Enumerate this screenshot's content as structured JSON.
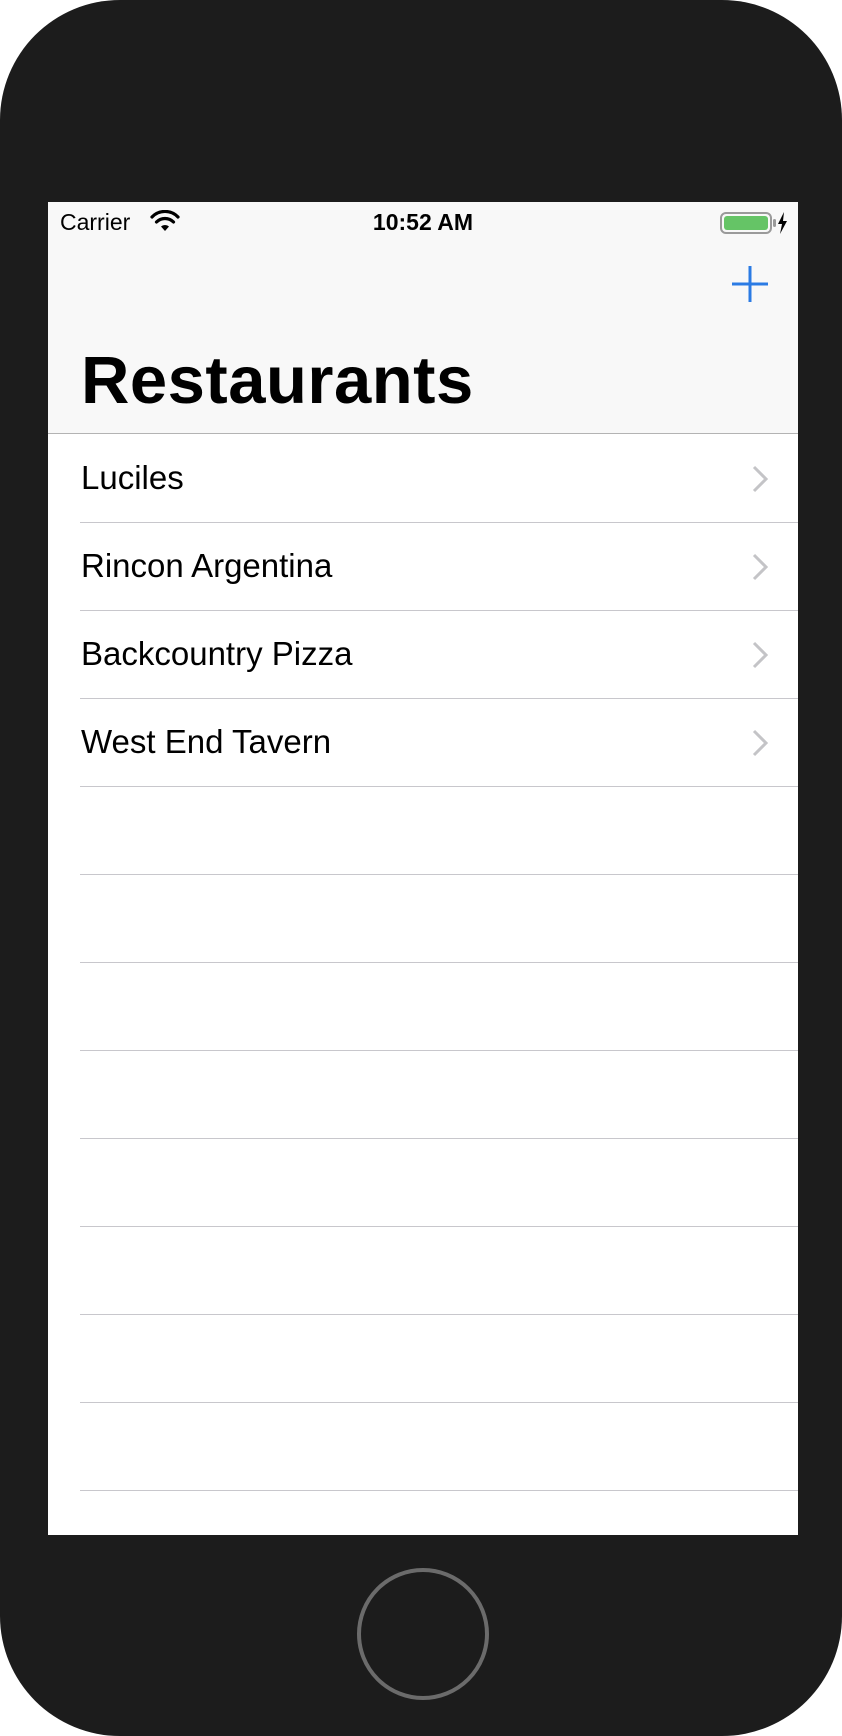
{
  "status_bar": {
    "carrier": "Carrier",
    "time": "10:52 AM",
    "wifi_icon": "wifi-icon",
    "battery_icon": "battery-charging-icon",
    "battery_color": "#65c466"
  },
  "navbar": {
    "title": "Restaurants",
    "add_icon": "plus-icon",
    "accent_color": "#2b7be4"
  },
  "restaurants": [
    {
      "name": "Luciles"
    },
    {
      "name": "Rincon Argentina"
    },
    {
      "name": "Backcountry Pizza"
    },
    {
      "name": "West End Tavern"
    }
  ]
}
